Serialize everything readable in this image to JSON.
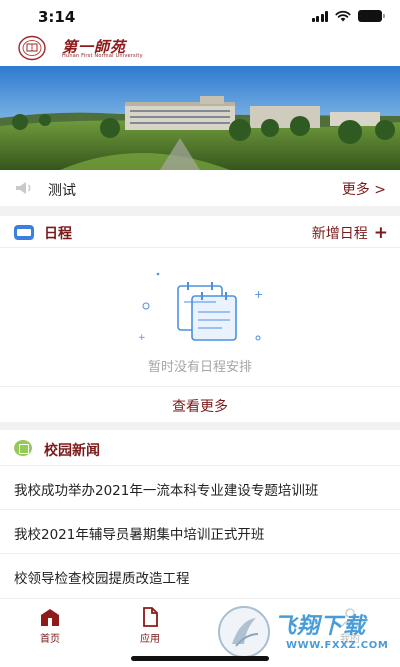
{
  "status_bar": {
    "time": "3:14"
  },
  "header": {
    "logo_text": "第一師苑",
    "logo_subtitle": "Hunan First Normal University"
  },
  "notice": {
    "text": "测试",
    "more_label": "更多 >"
  },
  "schedule": {
    "title": "日程",
    "add_label": "新增日程",
    "add_symbol": "+",
    "empty_text": "暂时没有日程安排",
    "view_more_label": "查看更多"
  },
  "news": {
    "title": "校园新闻",
    "items": [
      "我校成功举办2021年一流本科专业建设专题培训班",
      "我校2021年辅导员暑期集中培训正式开班",
      "校领导检查校园提质改造工程"
    ]
  },
  "tabbar": {
    "home_label": "首页",
    "apps_label": "应用",
    "msg_label": "我的"
  },
  "watermark": {
    "brand": "飞翔下载",
    "url": "WWW.FXXZ.COM"
  },
  "colors": {
    "brand": "#7a1a1a",
    "accent_blue": "#3b7fe0",
    "news_icon": "#95c95a"
  }
}
